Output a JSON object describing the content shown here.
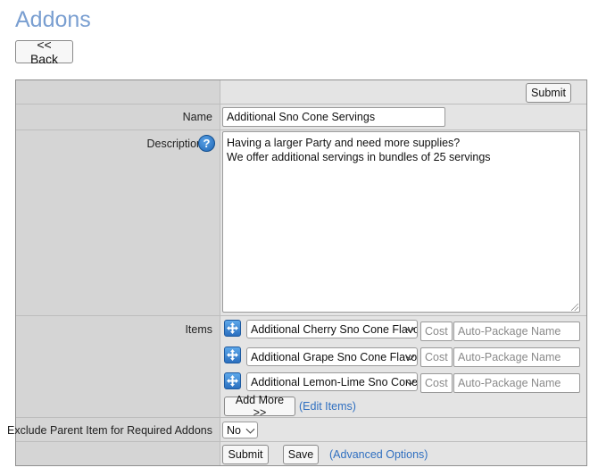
{
  "page": {
    "title": "Addons"
  },
  "nav": {
    "back_label": "<< Back"
  },
  "form": {
    "submit_top_label": "Submit",
    "name": {
      "label": "Name",
      "value": "Additional Sno Cone Servings"
    },
    "description": {
      "label": "Description",
      "help_icon": "?",
      "lines": [
        "Having a larger Party and need more supplies?",
        "We offer additional servings in bundles of 25 servings"
      ]
    },
    "items": {
      "label": "Items",
      "rows": [
        {
          "selected": "Additional Cherry Sno Cone Flavor",
          "cost_placeholder": "Cost",
          "package_placeholder": "Auto-Package Name"
        },
        {
          "selected": "Additional Grape Sno Cone Flavor",
          "cost_placeholder": "Cost",
          "package_placeholder": "Auto-Package Name"
        },
        {
          "selected": "Additional Lemon-Lime Sno Cone Flavor",
          "cost_placeholder": "Cost",
          "package_placeholder": "Auto-Package Name"
        }
      ],
      "add_more_label": "Add More >>",
      "edit_items_label": "(Edit Items)"
    },
    "exclude_parent": {
      "label": "Exclude Parent Item for Required Addons",
      "selected": "No"
    },
    "footer": {
      "submit_label": "Submit",
      "save_label": "Save",
      "advanced_label": "(Advanced Options)"
    }
  },
  "colors": {
    "accent_title": "#7a9fd1",
    "link": "#2f6fc0",
    "icon_blue": "#2b6fbf"
  },
  "icons": {
    "item_handle": "move-arrows-icon",
    "help": "help-icon"
  }
}
